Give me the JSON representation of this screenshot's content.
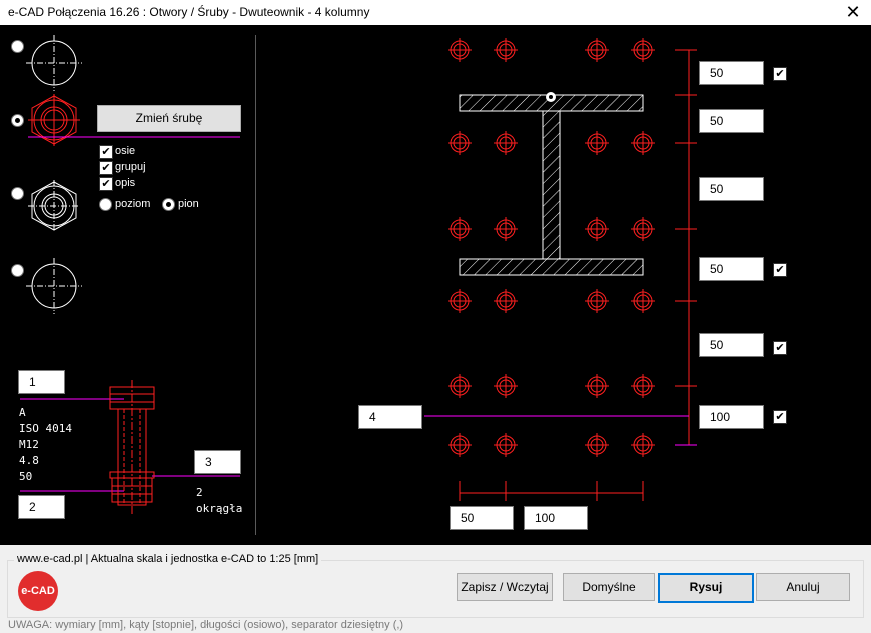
{
  "window": {
    "title": "e-CAD Połączenia 16.26 : Otwory / Śruby - Dwuteownik - 4 kolumny",
    "close": "✕"
  },
  "left": {
    "change_bolt": "Zmień śrubę",
    "options": {
      "axes": "osie",
      "group": "grupuj",
      "desc": "opis"
    },
    "orient": {
      "horizontal": "poziom",
      "vertical": "pion",
      "selected": "pion"
    },
    "field1": "1",
    "field2": "2",
    "field3": "3",
    "bolt_desc": [
      "A",
      "ISO 4014",
      "M12",
      "4.8",
      "50"
    ],
    "nut_desc": [
      "2",
      "okrągła"
    ]
  },
  "right": {
    "vert_dims": [
      {
        "value": "50",
        "checked": true
      },
      {
        "value": "50",
        "checked": false
      },
      {
        "value": "50",
        "checked": false
      },
      {
        "value": "50",
        "checked": true
      },
      {
        "value": "50",
        "checked": true
      },
      {
        "value": "100",
        "checked": true
      }
    ],
    "horiz_dims": [
      "50",
      "100"
    ],
    "left_field": "4"
  },
  "footer": {
    "info": "www.e-cad.pl | Aktualna skala i jednostka e-CAD to 1:25 [mm]",
    "logo": "e-CAD",
    "buttons": {
      "save_load": "Zapisz / Wczytaj",
      "defaults": "Domyślne",
      "draw": "Rysuj",
      "cancel": "Anuluj"
    },
    "note": "UWAGA: wymiary [mm], kąty [stopnie], długości (osiowo), separator dziesiętny (,)"
  },
  "colors": {
    "bolt": "#ff2020",
    "magenta": "#ff00ff",
    "white": "#ffffff"
  }
}
